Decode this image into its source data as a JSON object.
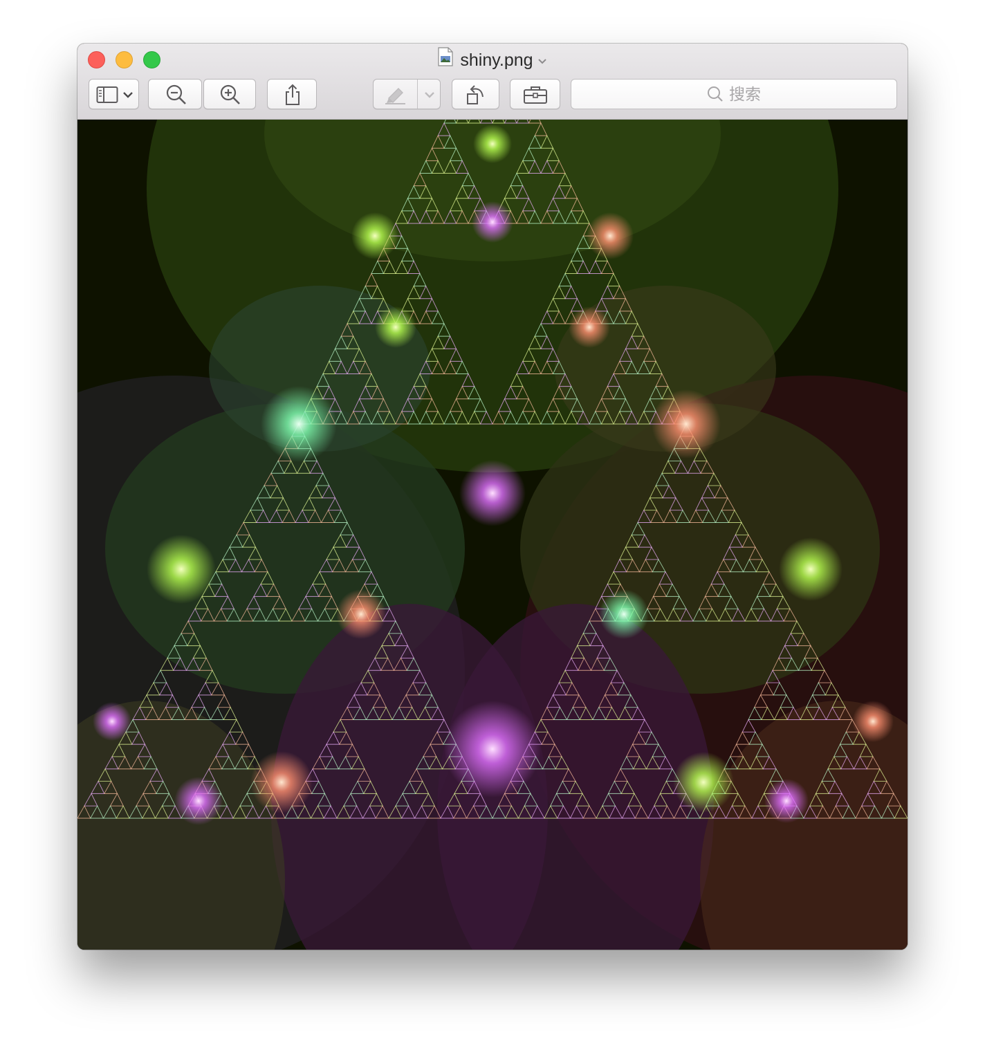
{
  "window": {
    "title": "shiny.png"
  },
  "toolbar": {
    "buttons": [
      {
        "name": "sidebar-toggle",
        "icon": "sidebar-icon"
      },
      {
        "name": "zoom-out",
        "icon": "zoom-out-icon"
      },
      {
        "name": "zoom-in",
        "icon": "zoom-in-icon"
      },
      {
        "name": "share",
        "icon": "share-icon"
      },
      {
        "name": "markup",
        "icon": "markup-pen-icon"
      },
      {
        "name": "rotate",
        "icon": "rotate-icon"
      },
      {
        "name": "toolbox",
        "icon": "toolbox-icon"
      }
    ],
    "search_placeholder": "搜索"
  },
  "image": {
    "description_colors": {
      "background": "#0e1200",
      "green_glow": "#b8ff50",
      "pink_glow": "#e070ff",
      "orange_glow": "#ff9070"
    }
  }
}
